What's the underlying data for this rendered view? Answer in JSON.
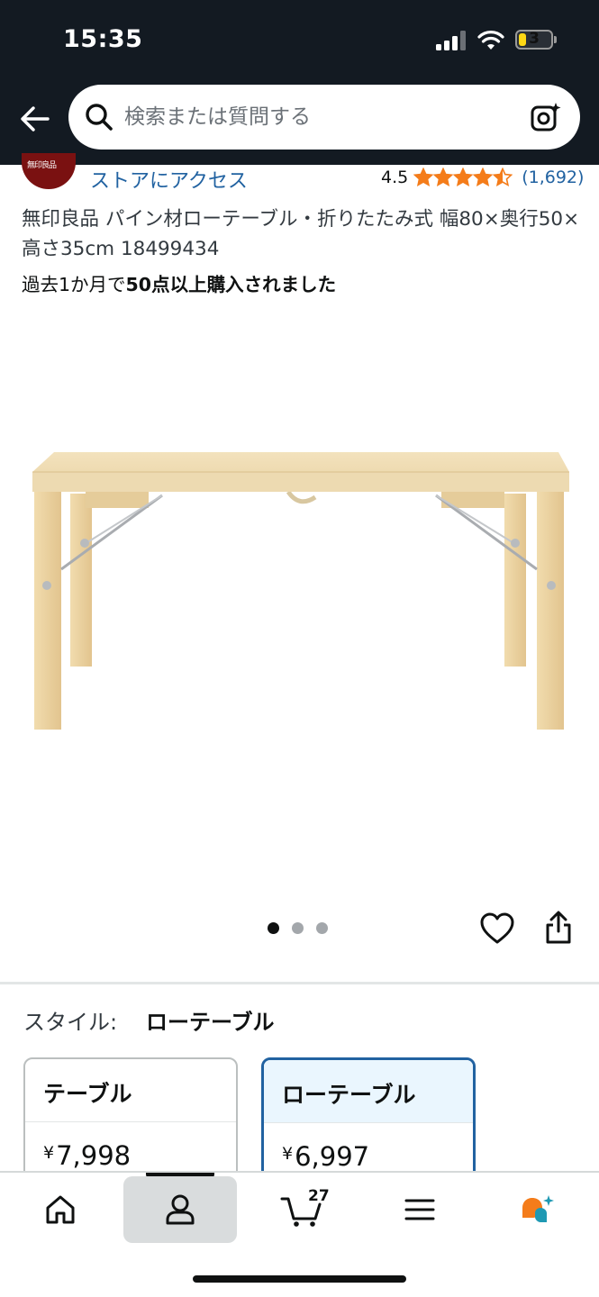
{
  "status_bar": {
    "time": "15:35",
    "battery": "3"
  },
  "search": {
    "placeholder": "検索または質問する"
  },
  "brand": {
    "store_link": "ストアにアクセス",
    "logo_text": "無印良品"
  },
  "rating": {
    "score": "4.5",
    "count": "(1,692)",
    "stars": 4.5
  },
  "product": {
    "title": "無印良品 パイン材ローテーブル・折りたたみ式 幅80×奥行50×高さ35cm 18499434",
    "purchased_prefix": "過去1か月で",
    "purchased_bold": "50点以上購入されました"
  },
  "carousel": {
    "total": 3,
    "active": 1
  },
  "style": {
    "label": "スタイル:",
    "value": "ローテーブル",
    "options": [
      {
        "name": "テーブル",
        "currency": "¥",
        "price": "7,998"
      },
      {
        "name": "ローテーブル",
        "currency": "¥",
        "price": "6,997"
      }
    ]
  },
  "bottom_nav": {
    "cart_count": "27"
  },
  "colors": {
    "header_bg": "#131a22",
    "link": "#2162a1",
    "star": "#f47c1a",
    "selected_border": "#2162a1"
  }
}
